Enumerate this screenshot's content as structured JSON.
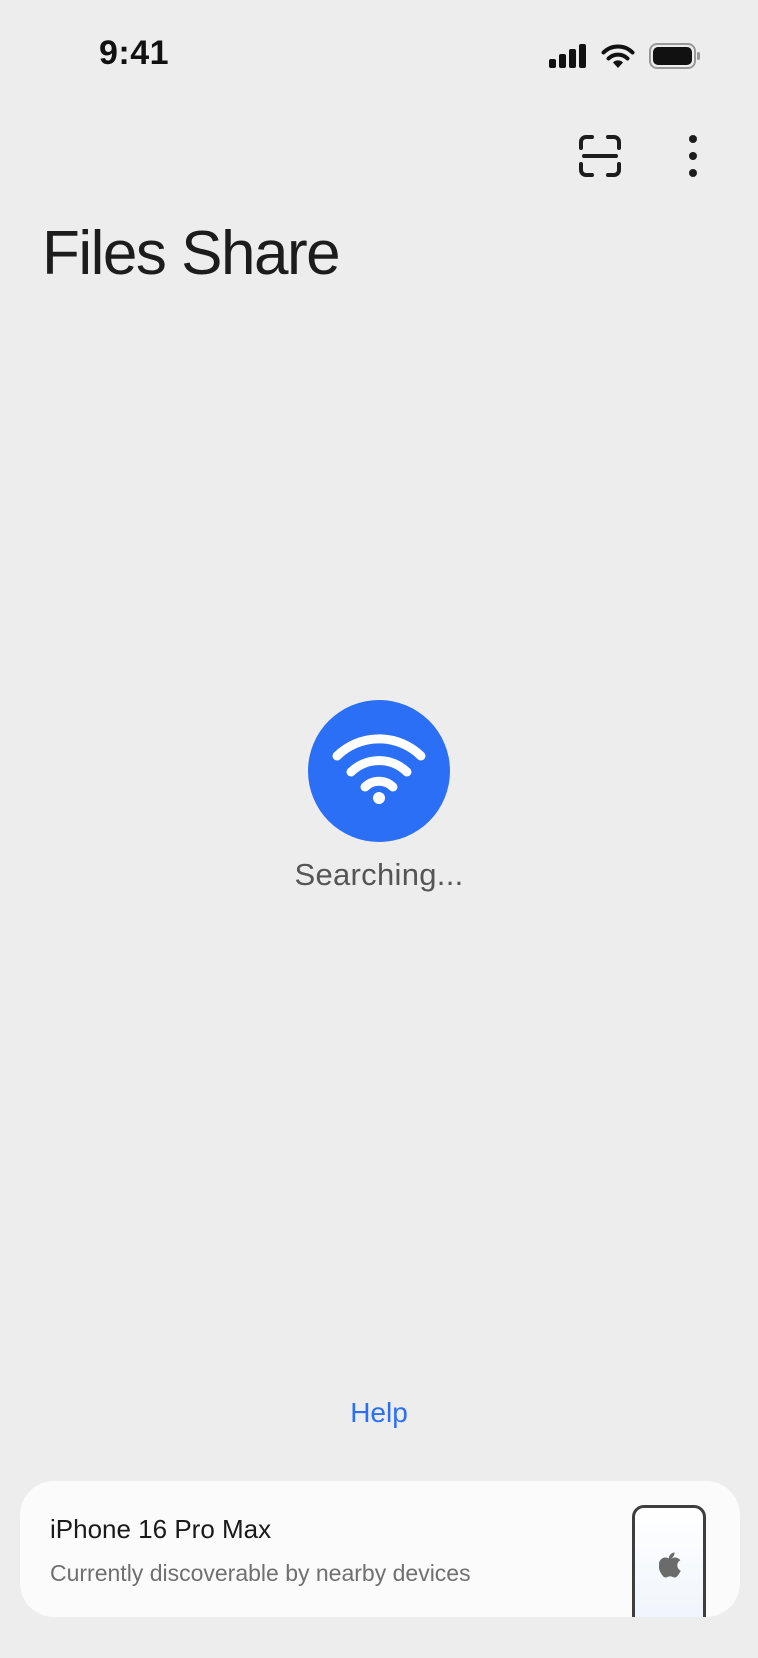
{
  "status_bar": {
    "time": "9:41",
    "icons": [
      "cellular-signal-icon",
      "wifi-icon",
      "battery-icon"
    ]
  },
  "toolbar": {
    "icons": [
      "scan-icon",
      "more-vertical-icon"
    ]
  },
  "page": {
    "title": "Files Share"
  },
  "search": {
    "icon": "wifi-icon",
    "status_text": "Searching..."
  },
  "help": {
    "label": "Help"
  },
  "device": {
    "name": "iPhone 16 Pro Max",
    "status": "Currently discoverable by nearby devices",
    "icon": "apple-logo-icon"
  },
  "colors": {
    "background": "#ededee",
    "accent": "#2a6ff5",
    "card": "#fbfbfb"
  }
}
